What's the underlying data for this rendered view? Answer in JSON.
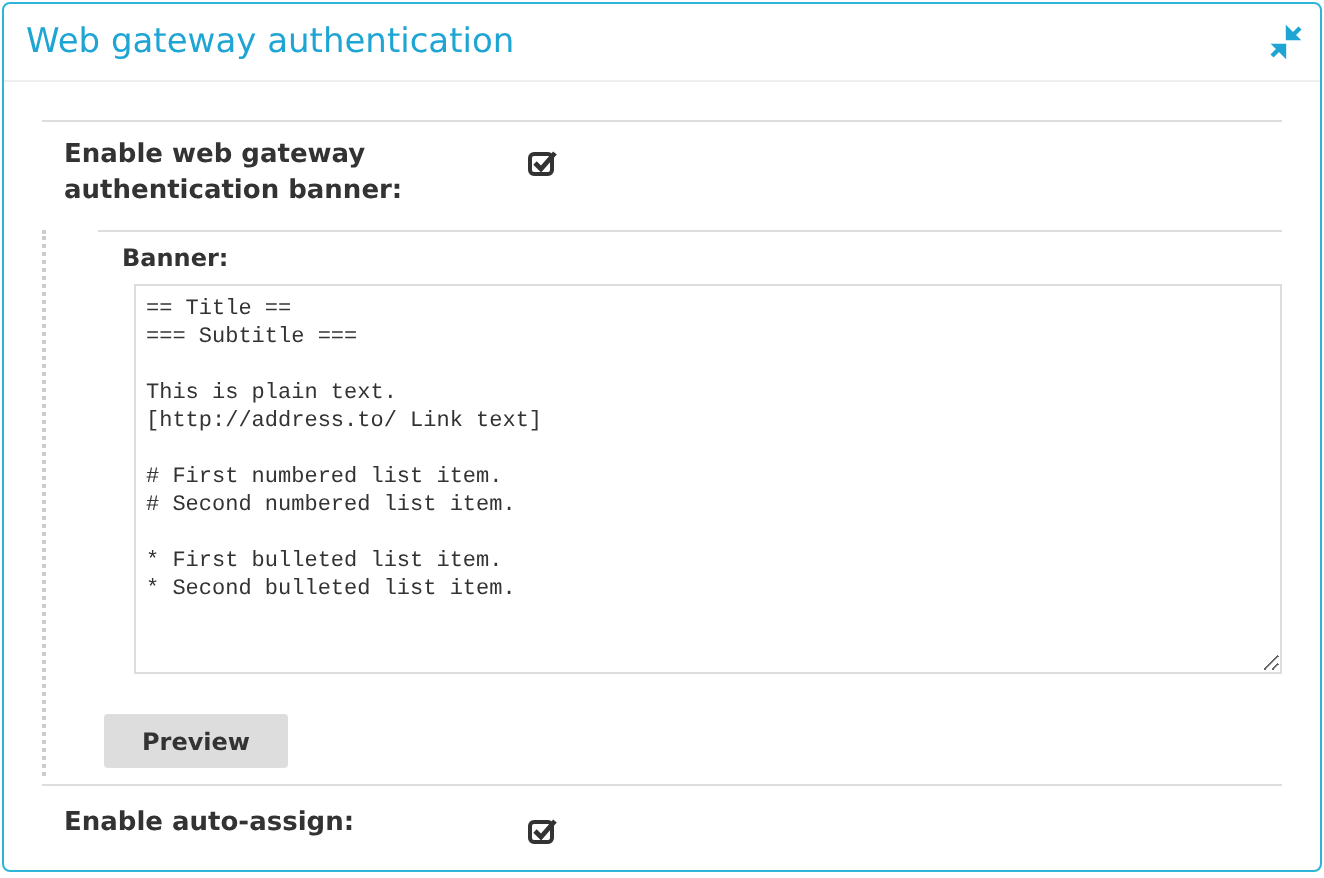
{
  "panel": {
    "title": "Web gateway authentication"
  },
  "banner_setting": {
    "label": "Enable web gateway authentication banner:",
    "checked": true
  },
  "banner": {
    "label": "Banner:",
    "value": "== Title ==\n=== Subtitle ===\n\nThis is plain text.\n[http://address.to/ Link text]\n\n# First numbered list item.\n# Second numbered list item.\n\n* First bulleted list item.\n* Second bulleted list item."
  },
  "preview_button": "Preview",
  "auto_assign": {
    "label": "Enable auto-assign:",
    "checked": true
  }
}
